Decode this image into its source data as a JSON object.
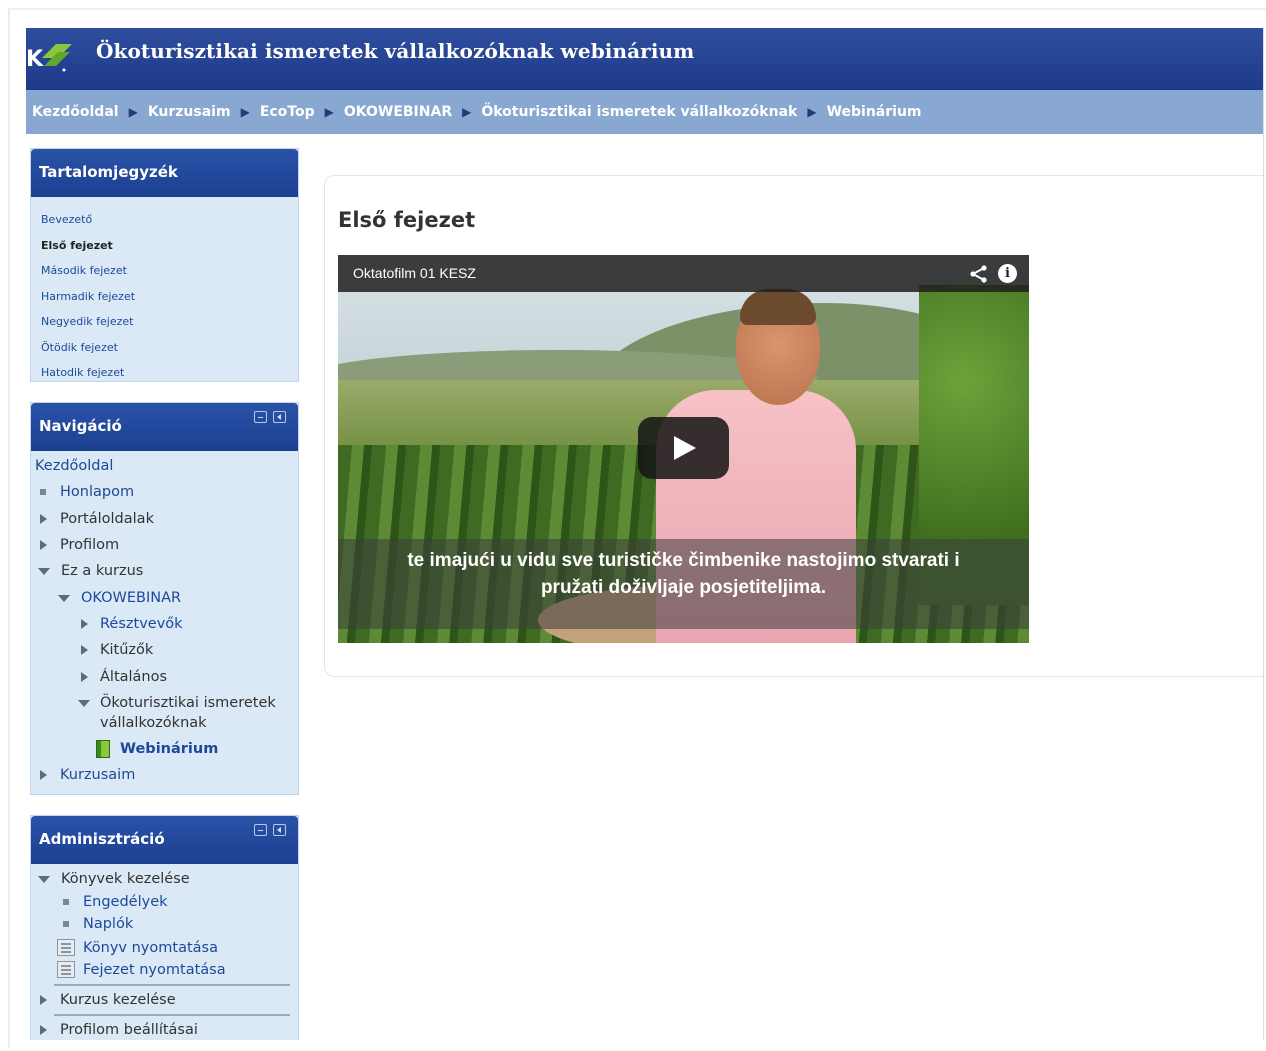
{
  "header": {
    "title": "Ökoturisztikai ismeretek vállalkozóknak webinárium"
  },
  "breadcrumb": [
    "Kezdőoldal",
    "Kurzusaim",
    "EcoTop",
    "OKOWEBINAR",
    "Ökoturisztikai ismeretek vállalkozóknak",
    "Webinárium"
  ],
  "toc": {
    "title": "Tartalomjegyzék",
    "items": [
      "Bevezető",
      "Első fejezet",
      "Második fejezet",
      "Harmadik fejezet",
      "Negyedik fejezet",
      "Ötödik fejezet",
      "Hatodik fejezet"
    ],
    "active": "Első fejezet"
  },
  "navigation": {
    "title": "Navigáció",
    "home": "Kezdőoldal",
    "items": {
      "honlapom": "Honlapom",
      "portaloldalak": "Portáloldalak",
      "profilom": "Profilom",
      "ez_a_kurzus": "Ez a kurzus",
      "okowebinar": "OKOWEBINAR",
      "resztvevok": "Résztvevők",
      "kituzok": "Kitűzők",
      "altalanos": "Általános",
      "okoturisztikai_line1": "Ökoturisztikai ismeretek",
      "okoturisztikai_line2": "vállalkozóknak",
      "webinarium": "Webinárium",
      "kurzusaim": "Kurzusaim"
    }
  },
  "administration": {
    "title": "Adminisztráció",
    "konyvek_kezelese": "Könyvek kezelése",
    "engedelyek": "Engedélyek",
    "naplok": "Naplók",
    "konyv_nyomtatasa": "Könyv nyomtatása",
    "fejezet_nyomtatasa": "Fejezet nyomtatása",
    "kurzus_kezelese": "Kurzus kezelése",
    "profilom_beallitasai": "Profilom beállításai"
  },
  "main": {
    "chapter_title": "Első fejezet",
    "video": {
      "title": "Oktatofilm 01 KESZ",
      "subtitle_line1": "te imajući u vidu sve turističke čimbenike nastojimo stvarati i",
      "subtitle_line2": "pružati doživljaje posjetiteljima."
    }
  },
  "colors": {
    "header_bg": "#1e3a8a",
    "breadcrumb_bg": "#88a8d2",
    "block_bg": "#dbe8f6",
    "link": "#1b4a9a"
  }
}
